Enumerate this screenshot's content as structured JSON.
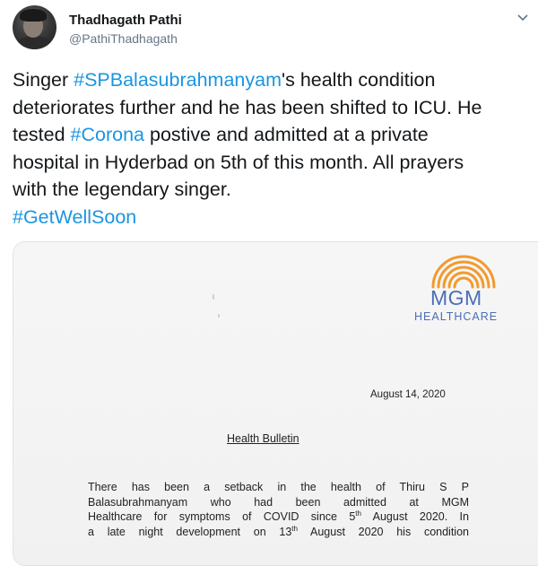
{
  "tweet": {
    "author": {
      "display_name": "Thadhagath Pathi",
      "handle": "@PathiThadhagath"
    },
    "text_lines": [
      [
        "Singer ",
        "#SPBalasubrahmanyam",
        "'s health condition"
      ],
      [
        "deteriorates further and he has been shifted to ICU.  He"
      ],
      [
        "tested ",
        "#Corona",
        " postive and admitted at a private"
      ],
      [
        "hospital in Hyderbad on 5th of this month. All prayers"
      ],
      [
        "with the legendary singer."
      ],
      [
        "#GetWellSoon"
      ]
    ],
    "hashtag_color": "#1b95e0"
  },
  "media": {
    "logo_word": "MGM",
    "logo_sub": "HEALTHCARE",
    "logo_color": "#4a6fb5",
    "logo_arc_color": "#f29a2e",
    "date": "August 14, 2020",
    "heading": "Health Bulletin",
    "body_lines": [
      "There has been a setback in the health of Thiru S P",
      "Balasubrahmanyam who had been admitted at MGM",
      "Healthcare for symptoms of COVID since 5th August 2020. In",
      "a late night development on 13th August 2020 his condition"
    ]
  }
}
